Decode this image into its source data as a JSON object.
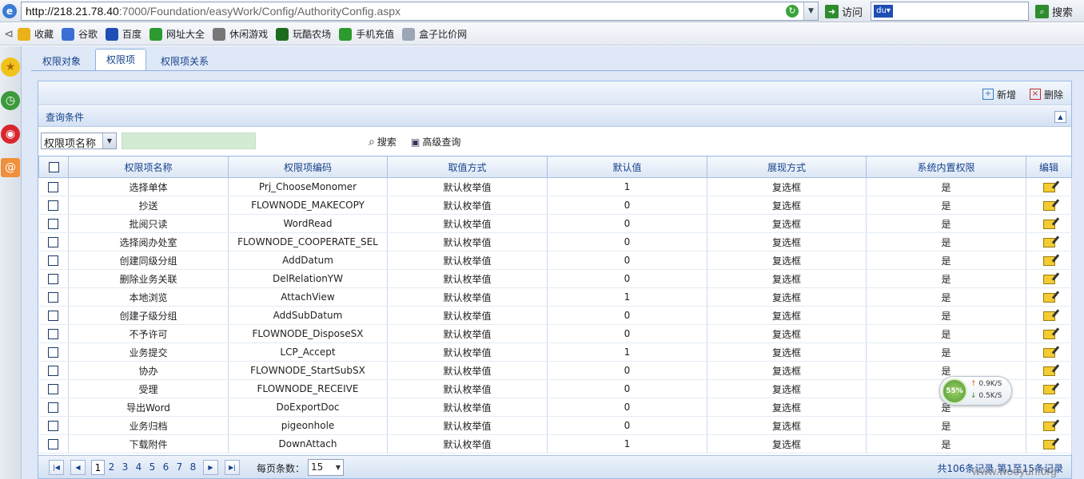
{
  "browser": {
    "url_host": "http://218.21.78.40",
    "url_rest": ":7000/Foundation/easyWork/Config/AuthorityConfig.aspx",
    "visit_label": "访问",
    "search_label": "搜索",
    "favorites": [
      {
        "label": "收藏",
        "icon": "star-icon",
        "color": "#e9b21b"
      },
      {
        "label": "谷歌",
        "icon": "google-icon",
        "color": "#3b6fd6"
      },
      {
        "label": "百度",
        "icon": "baidu-icon",
        "color": "#1f4fb5"
      },
      {
        "label": "网址大全",
        "icon": "web-directory-icon",
        "color": "#2d9a2d"
      },
      {
        "label": "休闲游戏",
        "icon": "gamepad-icon",
        "color": "#777777"
      },
      {
        "label": "玩酷农场",
        "icon": "farm-icon",
        "color": "#1c6b1c"
      },
      {
        "label": "手机充值",
        "icon": "mobile-topup-icon",
        "color": "#2d9a2d"
      },
      {
        "label": "盒子比价网",
        "icon": "page-icon",
        "color": "#9aa6b4"
      }
    ]
  },
  "tabs": [
    {
      "label": "权限对象",
      "active": false
    },
    {
      "label": "权限项",
      "active": true
    },
    {
      "label": "权限项关系",
      "active": false
    }
  ],
  "toolbar": {
    "add_label": "新增",
    "delete_label": "删除"
  },
  "query": {
    "title": "查询条件",
    "field_selected": "权限项名称",
    "input_value": "",
    "search_label": "搜索",
    "advanced_label": "高级查询"
  },
  "grid": {
    "columns": [
      "权限项名称",
      "权限项编码",
      "取值方式",
      "默认值",
      "展现方式",
      "系统内置权限",
      "编辑"
    ],
    "rows": [
      [
        "选择单体",
        "Prj_ChooseMonomer",
        "默认枚举值",
        "1",
        "复选框",
        "是"
      ],
      [
        "抄送",
        "FLOWNODE_MAKECOPY",
        "默认枚举值",
        "0",
        "复选框",
        "是"
      ],
      [
        "批阅只读",
        "WordRead",
        "默认枚举值",
        "0",
        "复选框",
        "是"
      ],
      [
        "选择阅办处室",
        "FLOWNODE_COOPERATE_SEL",
        "默认枚举值",
        "0",
        "复选框",
        "是"
      ],
      [
        "创建同级分组",
        "AddDatum",
        "默认枚举值",
        "0",
        "复选框",
        "是"
      ],
      [
        "删除业务关联",
        "DelRelationYW",
        "默认枚举值",
        "0",
        "复选框",
        "是"
      ],
      [
        "本地浏览",
        "AttachView",
        "默认枚举值",
        "1",
        "复选框",
        "是"
      ],
      [
        "创建子级分组",
        "AddSubDatum",
        "默认枚举值",
        "0",
        "复选框",
        "是"
      ],
      [
        "不予许可",
        "FLOWNODE_DisposeSX",
        "默认枚举值",
        "0",
        "复选框",
        "是"
      ],
      [
        "业务提交",
        "LCP_Accept",
        "默认枚举值",
        "1",
        "复选框",
        "是"
      ],
      [
        "协办",
        "FLOWNODE_StartSubSX",
        "默认枚举值",
        "0",
        "复选框",
        "是"
      ],
      [
        "受理",
        "FLOWNODE_RECEIVE",
        "默认枚举值",
        "0",
        "复选框",
        "是"
      ],
      [
        "导出Word",
        "DoExportDoc",
        "默认枚举值",
        "0",
        "复选框",
        "是"
      ],
      [
        "业务归档",
        "pigeonhole",
        "默认枚举值",
        "0",
        "复选框",
        "是"
      ],
      [
        "下载附件",
        "DownAttach",
        "默认枚举值",
        "1",
        "复选框",
        "是"
      ]
    ]
  },
  "pager": {
    "pages": [
      "1",
      "2",
      "3",
      "4",
      "5",
      "6",
      "7",
      "8"
    ],
    "current_page": "1",
    "page_size_label": "每页条数：",
    "page_size": "15",
    "info": "共106条记录  第1至15条记录"
  },
  "net_widget": {
    "percent": "55%",
    "up": "0.9K/S",
    "down": "0.5K/S"
  },
  "watermark": "www.wooyun.org"
}
